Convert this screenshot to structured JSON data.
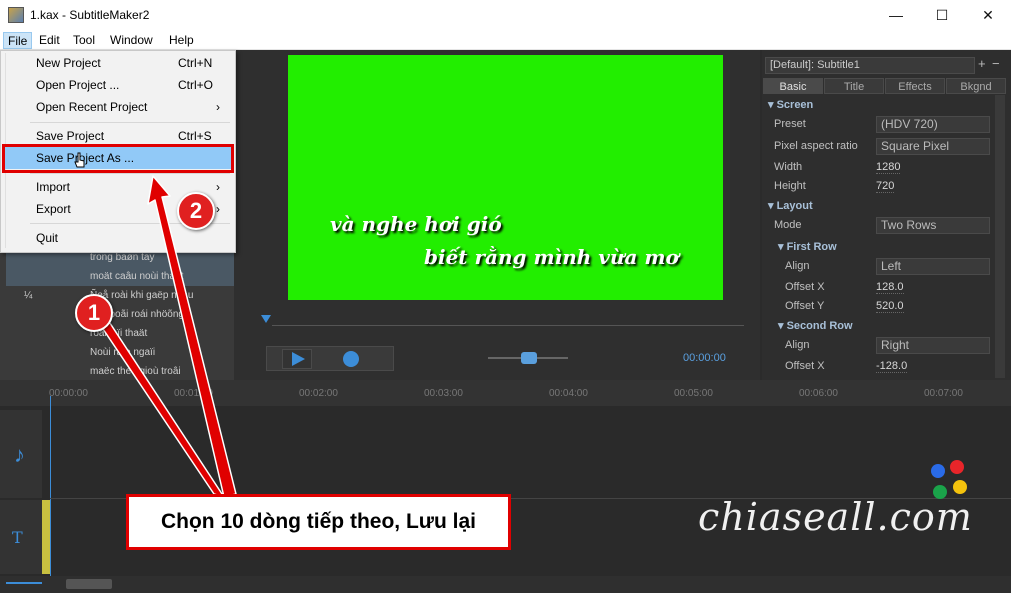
{
  "window": {
    "title": "1.kax - SubtitleMaker2"
  },
  "menubar": {
    "items": [
      "File",
      "Edit",
      "Tool",
      "Window",
      "Help"
    ]
  },
  "file_menu": {
    "items": [
      {
        "label": "New Project",
        "shortcut": "Ctrl+N"
      },
      {
        "label": "Open Project ...",
        "shortcut": "Ctrl+O"
      },
      {
        "label": "Open Recent Project",
        "submenu": "›"
      },
      {
        "label": "Save Project",
        "shortcut": "Ctrl+S"
      },
      {
        "label": "Save Project As ..."
      },
      {
        "label": "Import",
        "submenu": "›"
      },
      {
        "label": "Export",
        "submenu": "›"
      },
      {
        "label": "Quit"
      }
    ]
  },
  "subtitle_list": {
    "rows": [
      {
        "num": "",
        "text": "trong baøn tay"
      },
      {
        "num": "",
        "text": "moät caâu noùi thaät"
      },
      {
        "num": "¼",
        "text": "Ñeå roài khi gaëp nhau"
      },
      {
        "num": "",
        "text": "anh boãi roái nhöõng"
      },
      {
        "num": "",
        "text": "roài laïi thaät"
      },
      {
        "num": "",
        "text": "Noùi ra e ngaïi"
      },
      {
        "num": "",
        "text": "maëc theo gioù troâi"
      }
    ]
  },
  "preview": {
    "line1": "và nghe hơi gió",
    "line2": "biết rằng mình vừa mơ",
    "time": "00:00:00"
  },
  "properties": {
    "header": "[Default]: Subtitle1",
    "tabs": [
      "Basic",
      "Title",
      "Effects",
      "Bkgnd"
    ],
    "screen_section": "Screen",
    "preset_label": "Preset",
    "preset_value": "(HDV 720)",
    "par_label": "Pixel aspect ratio",
    "par_value": "Square Pixel",
    "width_label": "Width",
    "width_value": "1280",
    "height_label": "Height",
    "height_value": "720",
    "layout_section": "Layout",
    "mode_label": "Mode",
    "mode_value": "Two Rows",
    "first_row_section": "First Row",
    "align1_label": "Align",
    "align1_value": "Left",
    "offx1_label": "Offset X",
    "offx1_value": "128.0",
    "offy1_label": "Offset Y",
    "offy1_value": "520.0",
    "second_row_section": "Second Row",
    "align2_label": "Align",
    "align2_value": "Right",
    "offx2_label": "Offset X",
    "offx2_value": "-128.0"
  },
  "timeline": {
    "ticks": [
      "00:00:00",
      "00:01:00",
      "00:02:00",
      "00:03:00",
      "00:04:00",
      "00:05:00",
      "00:06:00",
      "00:07:00"
    ]
  },
  "annotations": {
    "badge1": "1",
    "badge2": "2",
    "callout": "Chọn 10 dòng tiếp theo, Lưu lại"
  },
  "watermark": "chiaseall.com",
  "colors": {
    "highlight": "#91c9f7",
    "annotation_red": "#e00000",
    "video_bg": "#22ee00"
  }
}
